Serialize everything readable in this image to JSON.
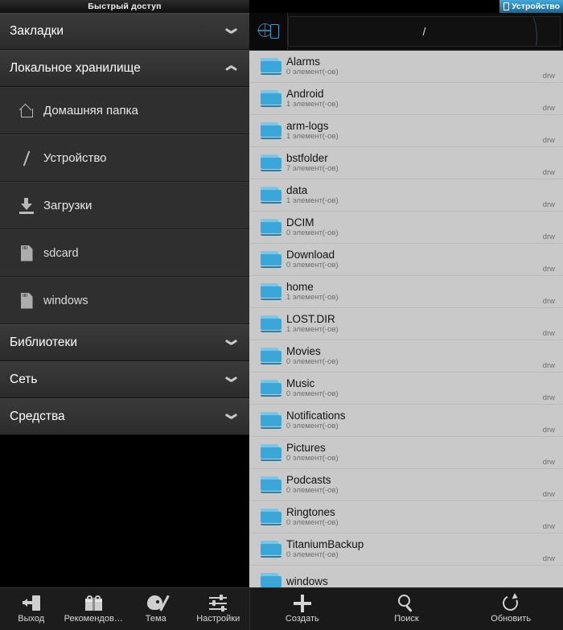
{
  "window": {
    "left_title": "Быстрый доступ",
    "device_tab_label": "Устройство"
  },
  "sidebar": {
    "sections": [
      {
        "label": "Закладки",
        "state": "collapsed",
        "chevron": "chevron-down-icon"
      },
      {
        "label": "Локальное хранилище",
        "state": "expanded",
        "chevron": "chevron-up-icon"
      }
    ],
    "items": [
      {
        "label": "Домашняя папка",
        "icon": "home-icon"
      },
      {
        "label": "Устройство",
        "icon": "root-slash-icon"
      },
      {
        "label": "Загрузки",
        "icon": "download-icon"
      },
      {
        "label": "sdcard",
        "icon": "sdcard-icon"
      },
      {
        "label": "windows",
        "icon": "sdcard-icon"
      }
    ],
    "footer_sections": [
      {
        "label": "Библиотеки",
        "state": "collapsed",
        "chevron": "chevron-down-icon"
      },
      {
        "label": "Сеть",
        "state": "collapsed",
        "chevron": "chevron-down-icon"
      },
      {
        "label": "Средства",
        "state": "collapsed",
        "chevron": "chevron-down-icon"
      }
    ]
  },
  "pathbar": {
    "home_icon": "globe-device-icon",
    "path": "/"
  },
  "filelist": {
    "permission_label": "drw",
    "rows": [
      {
        "name": "Alarms",
        "sub": "0 элемент(-ов)",
        "perm": "drw",
        "icon": "folder-icon"
      },
      {
        "name": "Android",
        "sub": "1 элемент(-ов)",
        "perm": "drw",
        "icon": "folder-icon"
      },
      {
        "name": "arm-logs",
        "sub": "1 элемент(-ов)",
        "perm": "drw",
        "icon": "folder-icon"
      },
      {
        "name": "bstfolder",
        "sub": "7 элемент(-ов)",
        "perm": "drw",
        "icon": "folder-icon"
      },
      {
        "name": "data",
        "sub": "1 элемент(-ов)",
        "perm": "drw",
        "icon": "folder-icon"
      },
      {
        "name": "DCIM",
        "sub": "0 элемент(-ов)",
        "perm": "drw",
        "icon": "folder-icon"
      },
      {
        "name": "Download",
        "sub": "0 элемент(-ов)",
        "perm": "drw",
        "icon": "folder-icon"
      },
      {
        "name": "home",
        "sub": "1 элемент(-ов)",
        "perm": "drw",
        "icon": "folder-icon"
      },
      {
        "name": "LOST.DIR",
        "sub": "1 элемент(-ов)",
        "perm": "drw",
        "icon": "folder-icon"
      },
      {
        "name": "Movies",
        "sub": "0 элемент(-ов)",
        "perm": "drw",
        "icon": "folder-icon"
      },
      {
        "name": "Music",
        "sub": "0 элемент(-ов)",
        "perm": "drw",
        "icon": "folder-icon"
      },
      {
        "name": "Notifications",
        "sub": "0 элемент(-ов)",
        "perm": "drw",
        "icon": "folder-icon"
      },
      {
        "name": "Pictures",
        "sub": "0 элемент(-ов)",
        "perm": "drw",
        "icon": "folder-icon"
      },
      {
        "name": "Podcasts",
        "sub": "0 элемент(-ов)",
        "perm": "drw",
        "icon": "folder-icon"
      },
      {
        "name": "Ringtones",
        "sub": "0 элемент(-ов)",
        "perm": "drw",
        "icon": "folder-icon"
      },
      {
        "name": "TitaniumBackup",
        "sub": "0 элемент(-ов)",
        "perm": "drw",
        "icon": "folder-icon"
      },
      {
        "name": "windows",
        "sub": "",
        "perm": "",
        "icon": "folder-icon"
      }
    ]
  },
  "bottom_left_toolbar": [
    {
      "label": "Выход",
      "icon": "exit-icon"
    },
    {
      "label": "Рекомендов…",
      "icon": "gift-icon"
    },
    {
      "label": "Тема",
      "icon": "palette-icon"
    },
    {
      "label": "Настройки",
      "icon": "sliders-icon"
    }
  ],
  "bottom_right_toolbar": [
    {
      "label": "Создать",
      "icon": "plus-icon"
    },
    {
      "label": "Поиск",
      "icon": "search-icon"
    },
    {
      "label": "Обновить",
      "icon": "refresh-icon"
    }
  ],
  "colors": {
    "accent_blue": "#3ba7d9",
    "tab_blue": "#2a7fae",
    "list_bg": "#c9c9c9",
    "panel_dark": "#2f2f2f"
  }
}
